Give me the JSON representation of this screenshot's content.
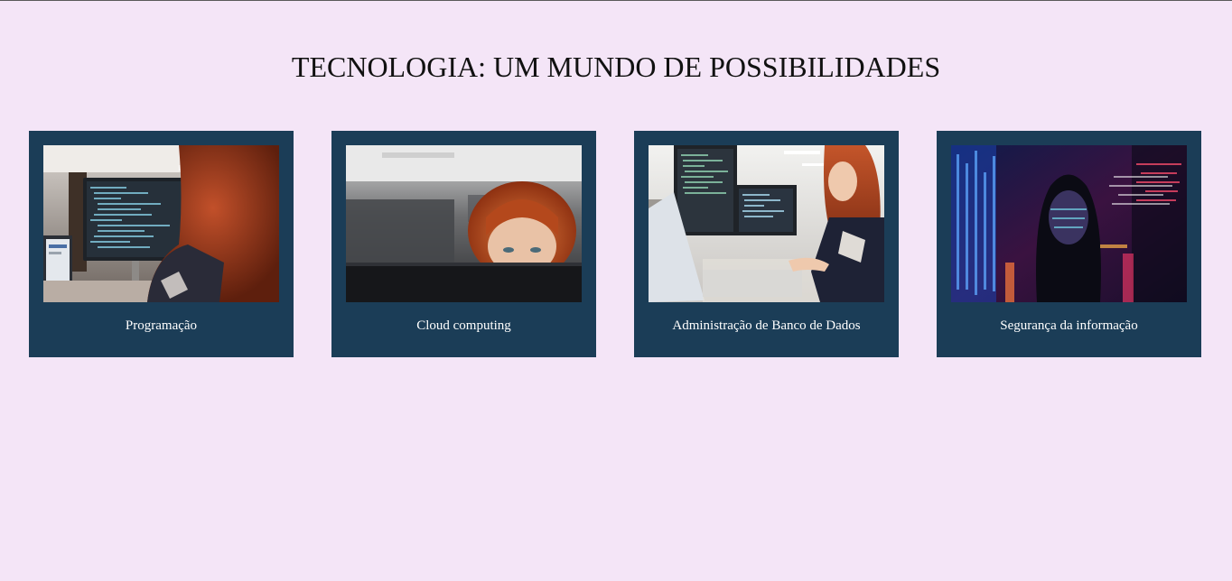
{
  "page": {
    "title": "TECNOLOGIA: UM MUNDO DE POSSIBILIDADES"
  },
  "cards": [
    {
      "caption": "Programação",
      "image": "woman-coding-at-monitors-photo"
    },
    {
      "caption": "Cloud computing",
      "image": "woman-peeking-over-monitor-photo"
    },
    {
      "caption": "Administração de Banco de Dados",
      "image": "woman-working-at-desk-photo"
    },
    {
      "caption": "Segurança da informação",
      "image": "woman-code-projection-photo"
    }
  ],
  "colors": {
    "background": "#f4e5f7",
    "card": "#1b3d57",
    "caption": "#ffffff"
  }
}
